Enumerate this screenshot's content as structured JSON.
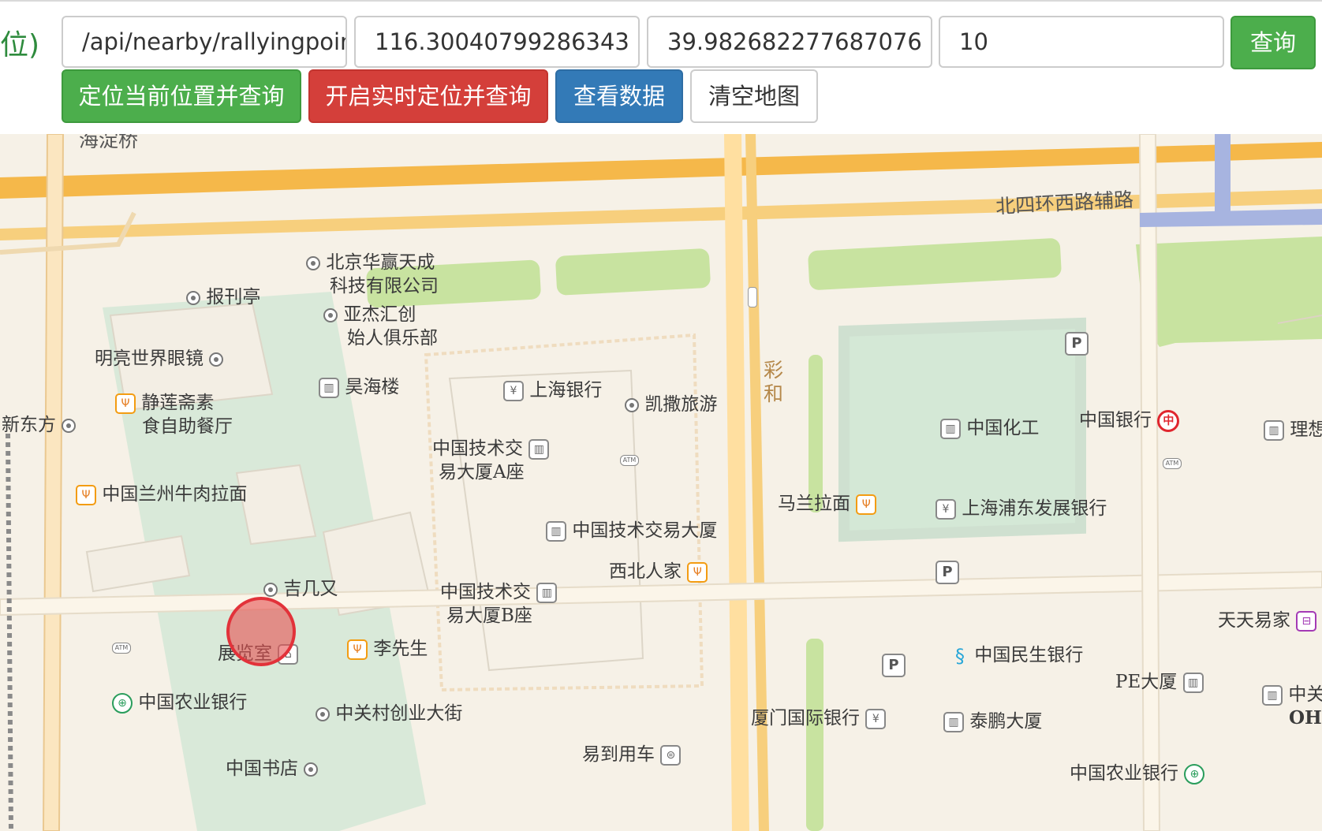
{
  "header": {
    "label_fragment": "位)",
    "api_path": "/api/nearby/rallyingpoint/",
    "longitude": "116.30040799286343",
    "latitude": "39.982682277687076",
    "radius": "10",
    "query_button": "查询",
    "locate_button": "定位当前位置并查询",
    "realtime_button": "开启实时定位并查询",
    "view_data_button": "查看数据",
    "clear_map_button": "清空地图"
  },
  "map": {
    "roads": {
      "north_4th_ring_aux": "北四环西路辅路",
      "caihe": "彩和",
      "haidian_bridge_fragment": "海淀桥"
    },
    "pois": {
      "huaying": "北京华赢天成",
      "huaying2": "科技有限公司",
      "newsstand": "报刊亭",
      "yajie": "亚杰汇创",
      "yajie2": "始人俱乐部",
      "mingliang": "明亮世界眼镜",
      "haohai": "昊海楼",
      "shanghai_bank": "上海银行",
      "kaisa": "凯撒旅游",
      "jinglian": "静莲斋素",
      "jinglian2": "食自助餐厅",
      "xdf": "新东方",
      "tech_a": "中国技术交",
      "tech_a2": "易大厦A座",
      "lanzhou": "中国兰州牛肉拉面",
      "tech_main": "中国技术交易大厦",
      "xibei": "西北人家",
      "jijiyou": "吉几又",
      "tech_b": "中国技术交",
      "tech_b2": "易大厦B座",
      "exhibition": "展览室",
      "lixiansheng": "李先生",
      "abc_left": "中国农业银行",
      "zgc_street": "中关村创业大街",
      "bookstore": "中国书店",
      "yidao": "易到用车",
      "chem": "中国化工",
      "boc": "中国银行",
      "lixiang": "理想",
      "malan": "马兰拉面",
      "spdb": "上海浦东发展银行",
      "tiantian": "天天易家",
      "cmbc": "中国民生银行",
      "pe": "PE大厦",
      "zhongguan": "中关",
      "ohc": "OHC",
      "xiamen": "厦门国际银行",
      "taipeng": "泰鹏大厦",
      "abc_right": "中国农业银行"
    }
  }
}
